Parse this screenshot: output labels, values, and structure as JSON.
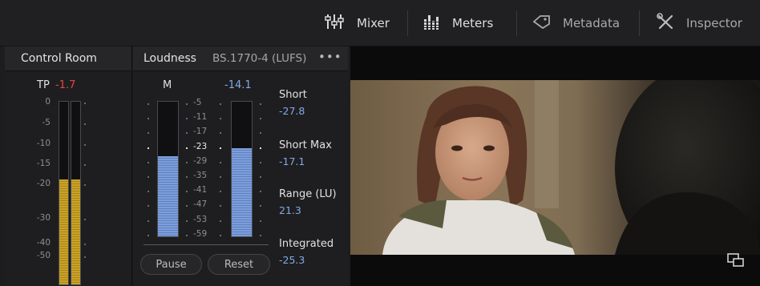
{
  "toolbar": {
    "mixer": "Mixer",
    "meters": "Meters",
    "metadata": "Metadata",
    "inspector": "Inspector"
  },
  "control_room": {
    "title": "Control Room",
    "tp_label": "TP",
    "tp_value": "-1.7",
    "level_fraction": 0.57,
    "scale": [
      "0",
      "-5",
      "-10",
      "-15",
      "-20",
      "-30",
      "-40",
      "-50"
    ]
  },
  "loudness": {
    "title": "Loudness",
    "standard": "BS.1770-4 (LUFS)",
    "menu": "•••",
    "m_label": "M",
    "m_value": "-14.1",
    "left_meter_fraction": 0.59,
    "right_meter_fraction": 0.65,
    "scale": [
      "-5",
      "-11",
      "-17",
      "-23",
      "-29",
      "-35",
      "-41",
      "-47",
      "-53",
      "-59"
    ],
    "highlight_tick": "-23",
    "readouts": {
      "short_label": "Short",
      "short_value": "-27.8",
      "short_max_label": "Short Max",
      "short_max_value": "-17.1",
      "range_label": "Range (LU)",
      "range_value": "21.3",
      "integrated_label": "Integrated",
      "integrated_value": "-25.3"
    },
    "pause_label": "Pause",
    "reset_label": "Reset"
  },
  "colors": {
    "peak_red": "#e5483f",
    "value_blue": "#84a9e6",
    "meter_yellow": "#c9a227",
    "meter_blue": "#7c9fdc"
  },
  "icons": [
    "mixer-sliders-icon",
    "meters-bars-icon",
    "metadata-tag-icon",
    "inspector-tools-icon",
    "fullscreen-icon"
  ]
}
